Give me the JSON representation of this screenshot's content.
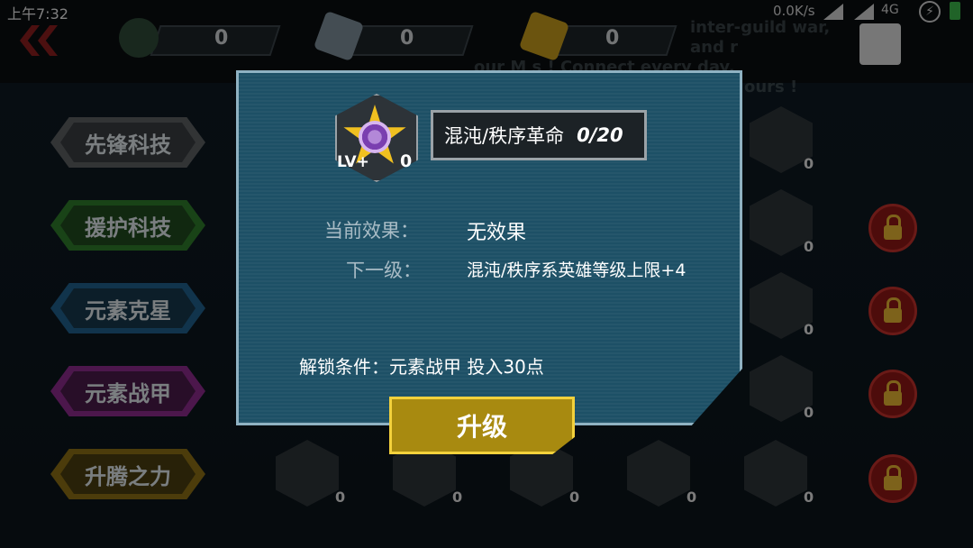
{
  "status_bar": {
    "time": "上午7:32",
    "network_speed": "0.0K/s",
    "network_type": "4G"
  },
  "top_bar": {
    "resources": [
      {
        "icon": "shield-icon",
        "value": "0"
      },
      {
        "icon": "silver-cube-icon",
        "value": "0"
      },
      {
        "icon": "gold-cube-icon",
        "value": "0"
      }
    ],
    "ticker_text_line1": "inter-guild war, and r",
    "ticker_text_line2": "our M                s ! Connect every day,",
    "ticker_text_line3": "ours !"
  },
  "tabs": [
    {
      "label": "先锋科技",
      "color": "#6b6f72"
    },
    {
      "label": "援护科技",
      "color": "#2f7a2a"
    },
    {
      "label": "元素克星",
      "color": "#1f5f8a"
    },
    {
      "label": "元素战甲",
      "color": "#8a2a8a"
    },
    {
      "label": "升腾之力",
      "color": "#8a6e14"
    }
  ],
  "grid_counts": {
    "right_column": [
      "0",
      "0",
      "0",
      "0",
      "0"
    ],
    "bottom_row": [
      "0",
      "0",
      "0",
      "0",
      "0"
    ]
  },
  "dialog": {
    "skill_icon_level": "0",
    "skill_icon_badge": "LV+",
    "skill_name": "混沌/秩序革命",
    "skill_progress": "0/20",
    "current_effect_label": "当前效果：",
    "current_effect_value": "无效果",
    "next_level_label": "下一级：",
    "next_level_value": "混沌/秩序系英雄等级上限+4",
    "unlock_condition": "解锁条件：元素战甲 投入30点",
    "upgrade_button": "升级"
  },
  "colors": {
    "dialog_bg": "#1d5066",
    "upgrade_button": "#a88a10",
    "lock": "#8c1714"
  }
}
